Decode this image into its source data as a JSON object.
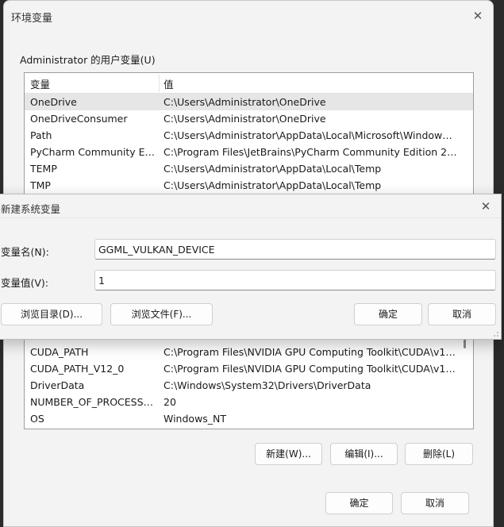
{
  "env_dialog": {
    "title": "环境变量",
    "close_glyph": "✕",
    "user_group_label": "Administrator 的用户变量(U)",
    "columns": {
      "name": "变量",
      "value": "值"
    },
    "user_vars": [
      {
        "name": "OneDrive",
        "value": "C:\\Users\\Administrator\\OneDrive"
      },
      {
        "name": "OneDriveConsumer",
        "value": "C:\\Users\\Administrator\\OneDrive"
      },
      {
        "name": "Path",
        "value": "C:\\Users\\Administrator\\AppData\\Local\\Microsoft\\WindowsA..."
      },
      {
        "name": "PyCharm Community Editi...",
        "value": "C:\\Program Files\\JetBrains\\PyCharm Community Edition 2025...."
      },
      {
        "name": "TEMP",
        "value": "C:\\Users\\Administrator\\AppData\\Local\\Temp"
      },
      {
        "name": "TMP",
        "value": "C:\\Users\\Administrator\\AppData\\Local\\Temp"
      }
    ],
    "sys_vars": [
      {
        "name": "CUDA_PATH",
        "value": "C:\\Program Files\\NVIDIA GPU Computing Toolkit\\CUDA\\v12.0"
      },
      {
        "name": "CUDA_PATH_V12_0",
        "value": "C:\\Program Files\\NVIDIA GPU Computing Toolkit\\CUDA\\v12.0"
      },
      {
        "name": "DriverData",
        "value": "C:\\Windows\\System32\\Drivers\\DriverData"
      },
      {
        "name": "NUMBER_OF_PROCESSORS",
        "value": "20"
      },
      {
        "name": "OS",
        "value": "Windows_NT"
      }
    ],
    "sys_buttons": {
      "new": "新建(W)...",
      "edit": "编辑(I)...",
      "delete": "删除(L)"
    },
    "footer_buttons": {
      "ok": "确定",
      "cancel": "取消"
    }
  },
  "new_var_dialog": {
    "title": "新建系统变量",
    "close_glyph": "✕",
    "name_label": "变量名(N):",
    "value_label": "变量值(V):",
    "name_value": "GGML_VULKAN_DEVICE",
    "value_value": "1",
    "browse_dir": "浏览目录(D)...",
    "browse_file": "浏览文件(F)...",
    "ok": "确定",
    "cancel": "取消"
  },
  "colors": {
    "dialog_bg": "#f3f3f3",
    "selected_row": "#e6e6e6",
    "list_border": "#9d9d9d"
  }
}
